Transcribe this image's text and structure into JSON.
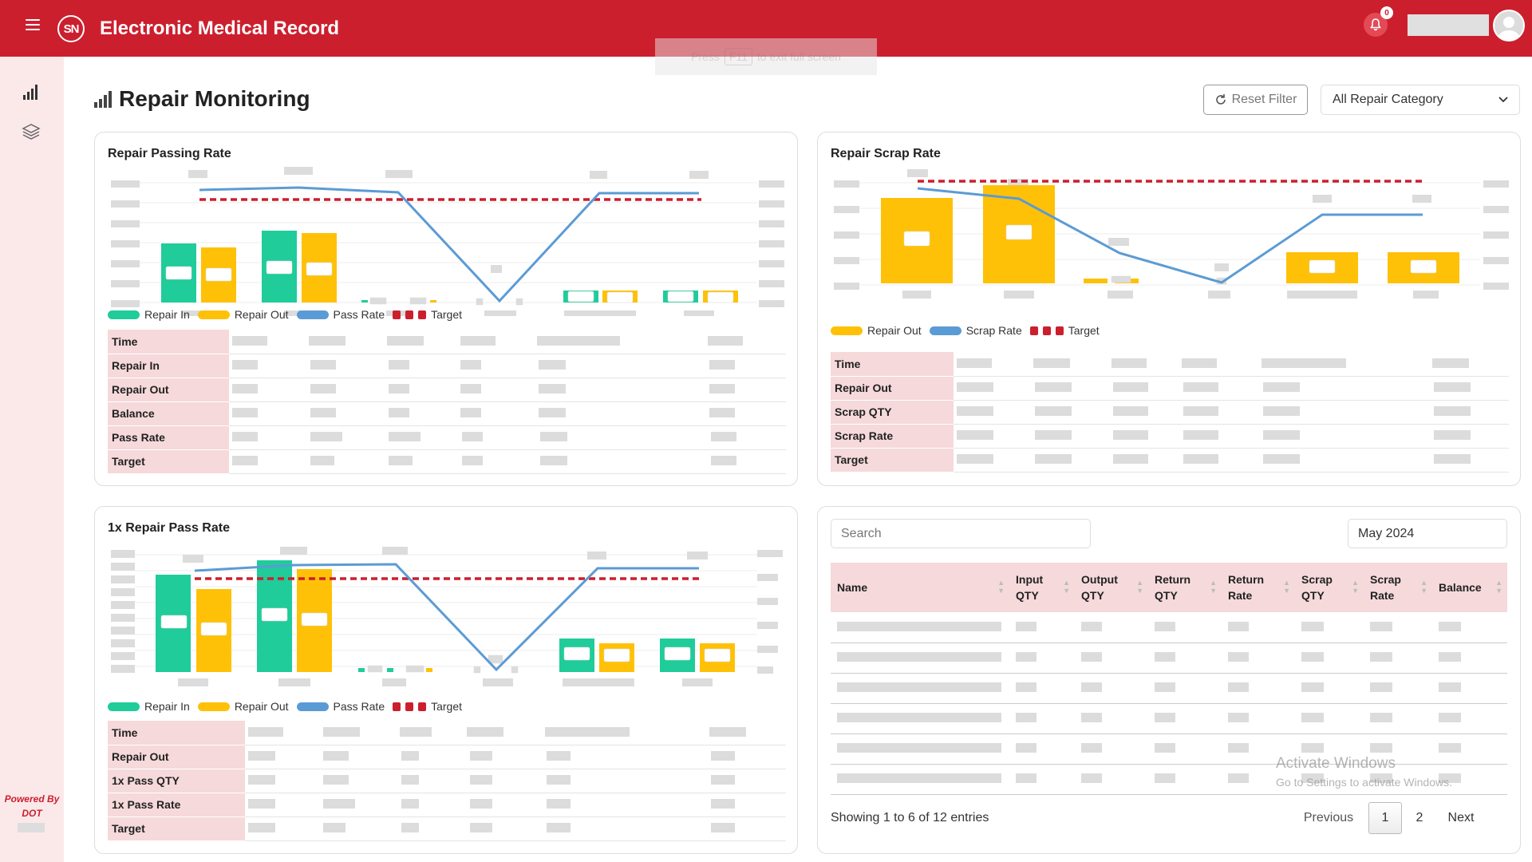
{
  "header": {
    "title": "Electronic Medical Record",
    "logo_text": "SN",
    "notification_count": "0",
    "fullscreen_hint": [
      "Press",
      "F11",
      "to exit full screen"
    ]
  },
  "sidebar": {
    "powered_by": "Powered By",
    "powered_name": "DOT",
    "items": [
      {
        "icon": "bar-chart-icon"
      },
      {
        "icon": "layers-icon"
      }
    ]
  },
  "page": {
    "title": "Repair Monitoring",
    "reset_filter": "Reset Filter",
    "category_selected": "All Repair Category"
  },
  "colors": {
    "brand": "#cc1f2e",
    "repair_in": "#1fcc9a",
    "repair_out": "#ffc107",
    "rate_line": "#5b9bd5",
    "target": "#cc1f2e"
  },
  "cards": {
    "passing": {
      "title": "Repair Passing Rate",
      "legend": {
        "repair_in": "Repair In",
        "repair_out": "Repair Out",
        "pass_rate": "Pass Rate",
        "target": "Target"
      },
      "rows": [
        "Time",
        "Repair In",
        "Repair Out",
        "Balance",
        "Pass Rate",
        "Target"
      ]
    },
    "scrap": {
      "title": "Repair Scrap Rate",
      "legend": {
        "repair_out": "Repair Out",
        "scrap_rate": "Scrap Rate",
        "target": "Target"
      },
      "rows": [
        "Time",
        "Repair Out",
        "Scrap QTY",
        "Scrap Rate",
        "Target"
      ]
    },
    "first": {
      "title": "1x Repair Pass Rate",
      "legend": {
        "repair_in": "Repair In",
        "repair_out": "Repair Out",
        "pass_rate": "Pass Rate",
        "target": "Target"
      },
      "rows": [
        "Time",
        "Repair Out",
        "1x Pass QTY",
        "1x Pass Rate",
        "Target"
      ]
    },
    "table": {
      "search_placeholder": "Search",
      "month": "May 2024",
      "columns": [
        {
          "l1": "Name",
          "l2": ""
        },
        {
          "l1": "Input",
          "l2": "QTY"
        },
        {
          "l1": "Output",
          "l2": "QTY"
        },
        {
          "l1": "Return",
          "l2": "QTY"
        },
        {
          "l1": "Return",
          "l2": "Rate"
        },
        {
          "l1": "Scrap",
          "l2": "QTY"
        },
        {
          "l1": "Scrap",
          "l2": "Rate"
        },
        {
          "l1": "Balance",
          "l2": ""
        }
      ],
      "info": "Showing 1 to 6 of 12 entries",
      "pagination": {
        "previous": "Previous",
        "pages": [
          "1",
          "2"
        ],
        "next": "Next"
      }
    }
  },
  "watermark": {
    "line1": "Activate Windows",
    "line2": "Go to Settings to activate Windows."
  }
}
